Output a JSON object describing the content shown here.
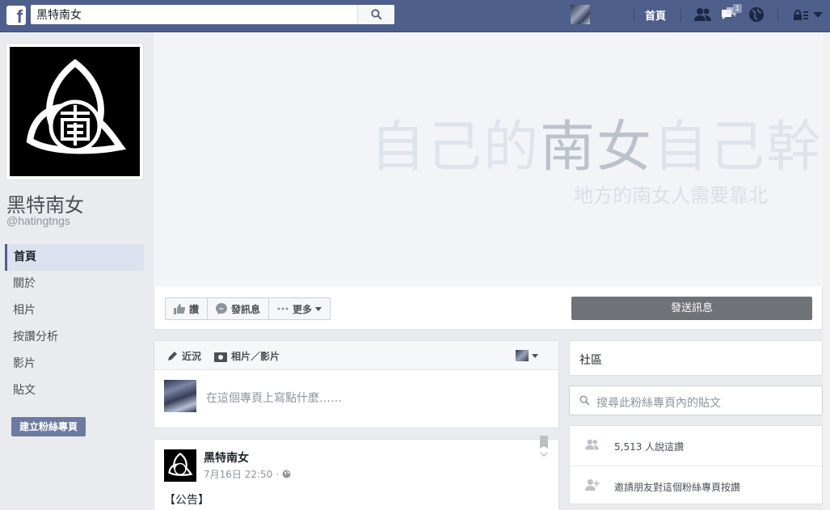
{
  "topbar": {
    "logo": "f",
    "search_value": "黑特南女",
    "home_label": "首頁",
    "notification_count": "1"
  },
  "page": {
    "name": "黑特南女",
    "handle": "@hatingtngs"
  },
  "nav": {
    "items": [
      {
        "label": "首頁"
      },
      {
        "label": "關於"
      },
      {
        "label": "相片"
      },
      {
        "label": "按讚分析"
      },
      {
        "label": "影片"
      },
      {
        "label": "貼文"
      }
    ],
    "create_button": "建立粉絲專頁"
  },
  "cover": {
    "line1_a": "自己的",
    "line1_b": "南女",
    "line1_c": "自己幹",
    "line2": "地方的南女人需要靠北"
  },
  "actions": {
    "like": "讚",
    "message": "發訊息",
    "more": "更多",
    "send_message": "發送訊息"
  },
  "composer": {
    "tab_status": "近況",
    "tab_photo": "相片／影片",
    "placeholder": "在這個專頁上寫點什麼……"
  },
  "post": {
    "author": "黑特南女",
    "time": "7月16日 22:50",
    "separator": "·",
    "text": "【公告】"
  },
  "sidebar_right": {
    "community": "社區",
    "search_placeholder": "搜尋此粉絲專頁內的貼文",
    "likes_text": "5,513 人說這讚",
    "invite_text": "邀請朋友對這個粉絲專頁按讚"
  },
  "colors": {
    "topbar": "#4e5f8c",
    "send_button": "#6f7378",
    "create_button": "#6d7aa0"
  }
}
